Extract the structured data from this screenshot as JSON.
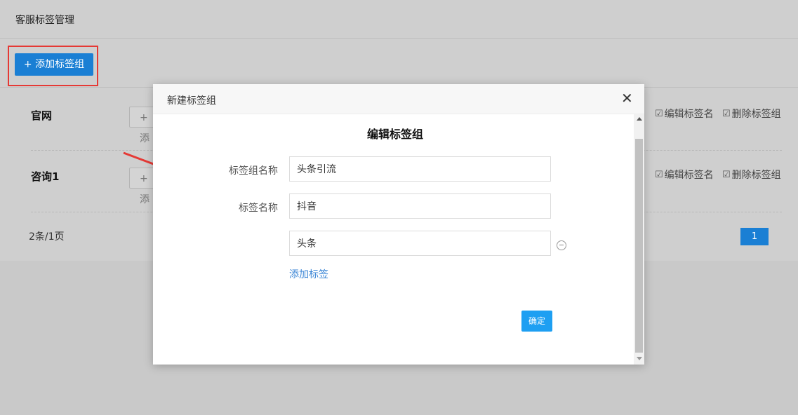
{
  "page": {
    "title": "客服标签管理",
    "add_group_button": "+ 添加标签组",
    "groups": [
      {
        "name": "官网",
        "add_tag_mini": "+ 添",
        "edit_label": "编辑标签名",
        "delete_label": "删除标签组"
      },
      {
        "name": "咨询1",
        "add_tag_mini": "+ 添",
        "edit_label": "编辑标签名",
        "delete_label": "删除标签组"
      }
    ],
    "pager": {
      "count_text": "2条/1页",
      "current_page": "1"
    }
  },
  "modal": {
    "title": "新建标签组",
    "heading": "编辑标签组",
    "group_name_label": "标签组名称",
    "group_name_value": "头条引流",
    "tag_name_label": "标签名称",
    "tags": [
      "抖音",
      "头条"
    ],
    "add_tag_link": "添加标签",
    "confirm_button": "确定"
  },
  "colors": {
    "primary": "#1a7fd4",
    "highlight": "#e53935",
    "link": "#3b86d6",
    "confirm": "#1e9ff2"
  }
}
